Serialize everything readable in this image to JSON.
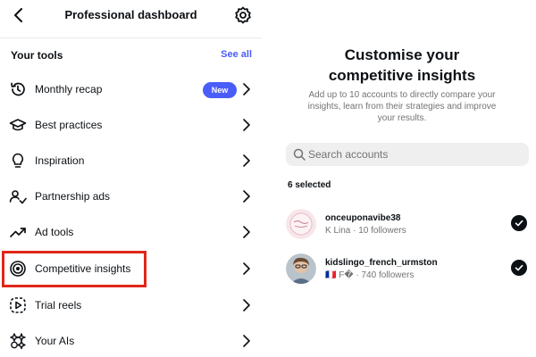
{
  "left": {
    "title": "Professional dashboard",
    "tools_header": "Your tools",
    "see_all": "See all",
    "items": [
      {
        "label": "Monthly recap",
        "badge": "New"
      },
      {
        "label": "Best practices"
      },
      {
        "label": "Inspiration"
      },
      {
        "label": "Partnership ads"
      },
      {
        "label": "Ad tools"
      },
      {
        "label": "Competitive insights"
      },
      {
        "label": "Trial reels"
      },
      {
        "label": "Your AIs"
      }
    ]
  },
  "right": {
    "title_line1": "Customise your",
    "title_line2": "competitive insights",
    "subtitle": "Add up to 10 accounts to directly compare your insights, learn from their strategies and improve your results.",
    "search_placeholder": "Search accounts",
    "selected_count": "6 selected",
    "accounts": [
      {
        "username": "onceuponavibe38",
        "meta": "K Lina · 10 followers"
      },
      {
        "username": "kidslingo_french_urmston",
        "meta": "🇫🇷 F� · 740 followers"
      }
    ]
  },
  "colors": {
    "accent": "#4a5df9",
    "highlight": "#e0271a",
    "text": "#0c1014",
    "muted": "#737373"
  }
}
